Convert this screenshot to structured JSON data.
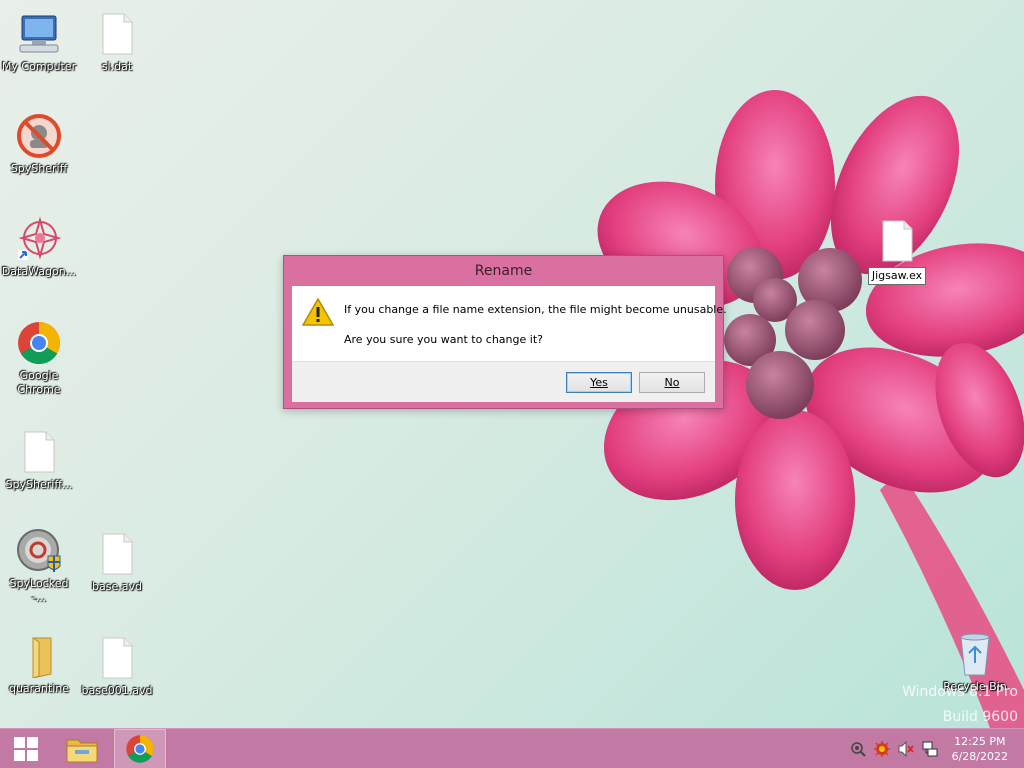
{
  "desktop": {
    "icons": [
      {
        "label": "My Computer",
        "icon": "computer-icon"
      },
      {
        "label": "sl.dat",
        "icon": "file-icon"
      },
      {
        "label": "SpySheriff",
        "icon": "spysheriff-icon"
      },
      {
        "label": "DataWagon...",
        "icon": "datawagon-icon"
      },
      {
        "label": "Google Chrome",
        "icon": "chrome-icon"
      },
      {
        "label": "SpySheriff...",
        "icon": "file-icon"
      },
      {
        "label": "SpyLocked -...",
        "icon": "spylocked-icon"
      },
      {
        "label": "base.avd",
        "icon": "file-icon"
      },
      {
        "label": "quarantine",
        "icon": "folder-icon"
      },
      {
        "label": "base001.avd",
        "icon": "file-icon"
      },
      {
        "label": "Jigsaw.ex",
        "icon": "file-icon"
      },
      {
        "label": "Recycle Bin",
        "icon": "recycle-bin-icon"
      }
    ],
    "watermark": {
      "line1": "Windows 8.1 Pro",
      "line2": "Build 9600"
    }
  },
  "dialog": {
    "title": "Rename",
    "message": "If you change a file name extension, the file might become unusable.",
    "question": "Are you sure you want to change it?",
    "yes_label": "Yes",
    "no_label": "No"
  },
  "taskbar": {
    "clock_time": "12:25 PM",
    "clock_date": "6/28/2022"
  },
  "colors": {
    "dialog_frame": "#d9709f",
    "taskbar": "#c27aa4",
    "flower": "#e8407f"
  }
}
